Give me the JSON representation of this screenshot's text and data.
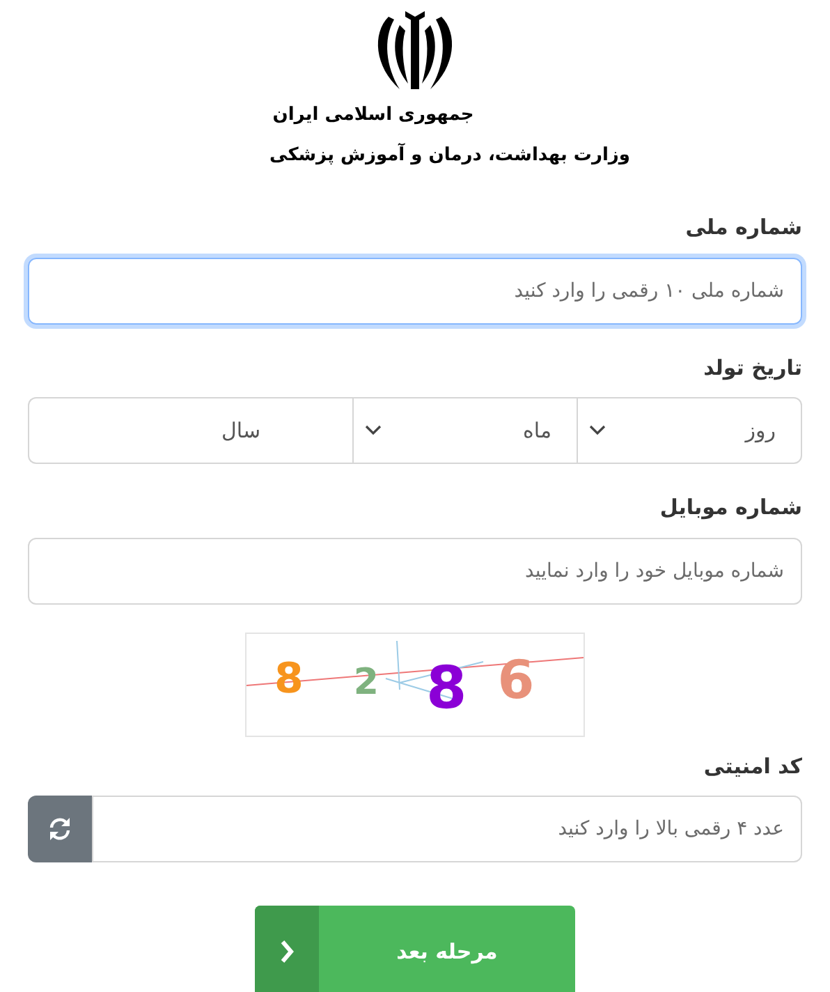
{
  "logo": {
    "lines": [
      "جمهوری اسلامی ایران",
      "وزارت بهداشت، درمان و آموزش پزشکی"
    ]
  },
  "national_id": {
    "label": "شماره ملی",
    "placeholder": "شماره ملی ۱۰ رقمی را وارد کنید",
    "focused": true
  },
  "birth_date": {
    "label": "تاریخ تولد",
    "selects": [
      {
        "placeholder": "روز",
        "caret": true
      },
      {
        "placeholder": "ماه",
        "caret": true
      },
      {
        "placeholder": "سال",
        "caret": false
      }
    ]
  },
  "mobile": {
    "label": "شماره موبایل",
    "placeholder": "شماره موبایل خود را وارد نمایید",
    "focused": false
  },
  "captcha": {
    "digits": [
      {
        "text": "6",
        "color": "#e8917a"
      },
      {
        "text": "8",
        "color": "#8b00d6"
      },
      {
        "text": "2",
        "color": "#7fb27f"
      },
      {
        "text": "8",
        "color": "#f7941d"
      }
    ]
  },
  "security_code": {
    "label": "کد امنیتی",
    "placeholder": "عدد ۴ رقمی بالا را وارد کنید",
    "focused": false
  },
  "next_button": {
    "label": "مرحله بعد"
  }
}
